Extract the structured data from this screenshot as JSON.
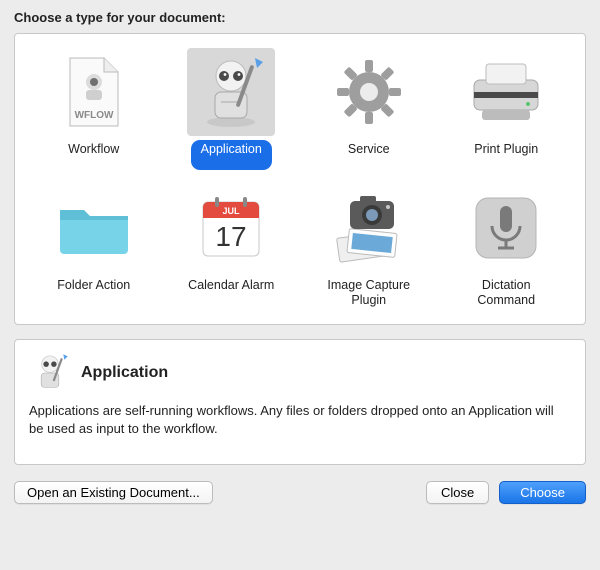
{
  "heading": "Choose a type for your document:",
  "types": [
    {
      "label": "Workflow"
    },
    {
      "label": "Application"
    },
    {
      "label": "Service"
    },
    {
      "label": "Print Plugin"
    },
    {
      "label": "Folder Action"
    },
    {
      "label": "Calendar Alarm"
    },
    {
      "label": "Image Capture\nPlugin"
    },
    {
      "label": "Dictation\nCommand"
    }
  ],
  "selected_index": 1,
  "detail": {
    "title": "Application",
    "description": "Applications are self-running workflows. Any files or folders dropped onto an Application will be used as input to the workflow."
  },
  "buttons": {
    "open": "Open an Existing Document...",
    "close": "Close",
    "choose": "Choose"
  },
  "icons": {
    "workflow": "workflow-document-icon",
    "application": "automator-robot-icon",
    "service": "gear-icon",
    "print_plugin": "printer-icon",
    "folder_action": "folder-icon",
    "calendar_alarm": "calendar-icon",
    "image_capture": "camera-photos-icon",
    "dictation": "microphone-icon"
  }
}
